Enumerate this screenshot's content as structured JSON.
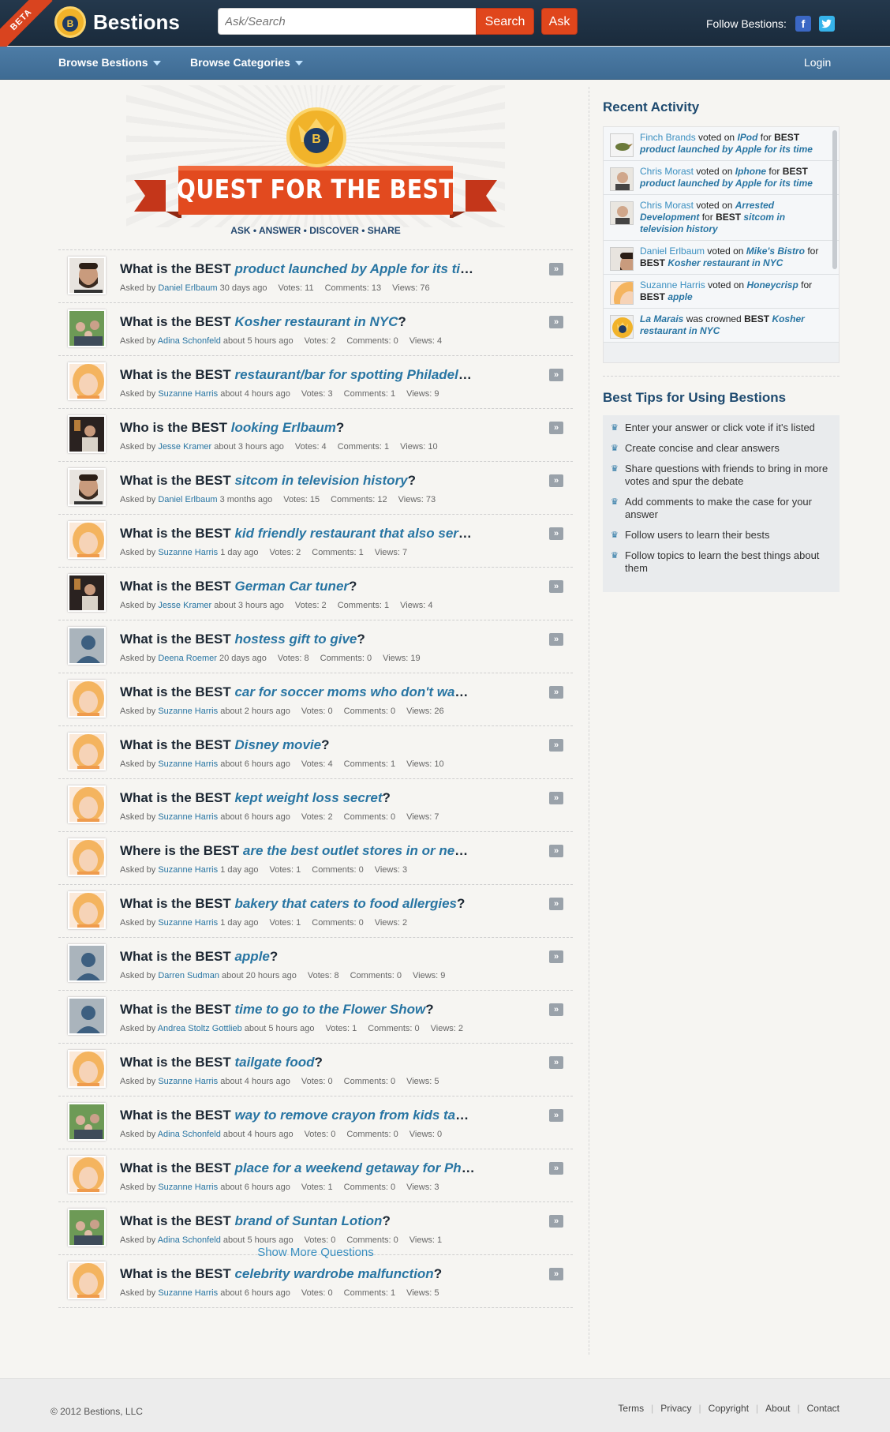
{
  "header": {
    "beta": "BETA",
    "logo_letter": "B",
    "logo_text": "Bestions",
    "search_placeholder": "Ask/Search",
    "search_label": "Search",
    "ask_label": "Ask",
    "follow_label": "Follow Bestions:",
    "facebook": "f",
    "twitter": "t"
  },
  "nav": {
    "browse_bestions": "Browse Bestions",
    "browse_categories": "Browse Categories",
    "login": "Login"
  },
  "hero": {
    "badge_letter": "B",
    "banner": "QUEST FOR THE BEST",
    "tagline": "ASK • ANSWER • DISCOVER • SHARE"
  },
  "questions": [
    {
      "prefix": "What is the BEST",
      "topic": "product launched by Apple for its time",
      "suffix": "?",
      "asker": "Daniel Erlbaum",
      "time": "30 days ago",
      "votes": "Votes: 11",
      "comments": "Comments: 13",
      "views": "Views: 76",
      "avatar": "man-beard"
    },
    {
      "prefix": "What is the BEST",
      "topic": "Kosher restaurant in NYC",
      "suffix": "?",
      "asker": "Adina Schonfeld",
      "time": "about 5 hours ago",
      "votes": "Votes: 2",
      "comments": "Comments: 0",
      "views": "Views: 4",
      "avatar": "family"
    },
    {
      "prefix": "What is the BEST",
      "topic": "restaurant/bar for spotting Philadelphia c...",
      "suffix": "",
      "asker": "Suzanne Harris",
      "time": "about 4 hours ago",
      "votes": "Votes: 3",
      "comments": "Comments: 1",
      "views": "Views: 9",
      "avatar": "blonde"
    },
    {
      "prefix": "Who is the BEST",
      "topic": "looking Erlbaum",
      "suffix": "?",
      "asker": "Jesse Kramer",
      "time": "about 3 hours ago",
      "votes": "Votes: 4",
      "comments": "Comments: 1",
      "views": "Views: 10",
      "avatar": "dark"
    },
    {
      "prefix": "What is the BEST",
      "topic": "sitcom in television history",
      "suffix": "?",
      "asker": "Daniel Erlbaum",
      "time": "3 months ago",
      "votes": "Votes: 15",
      "comments": "Comments: 12",
      "views": "Views: 73",
      "avatar": "man-beard"
    },
    {
      "prefix": "What is the BEST",
      "topic": "kid friendly restaurant that also serves alc...",
      "suffix": "",
      "asker": "Suzanne Harris",
      "time": "1 day ago",
      "votes": "Votes: 2",
      "comments": "Comments: 1",
      "views": "Views: 7",
      "avatar": "blonde"
    },
    {
      "prefix": "What is the BEST",
      "topic": "German Car tuner",
      "suffix": "?",
      "asker": "Jesse Kramer",
      "time": "about 3 hours ago",
      "votes": "Votes: 2",
      "comments": "Comments: 1",
      "views": "Views: 4",
      "avatar": "dark"
    },
    {
      "prefix": "What is the BEST",
      "topic": "hostess gift to give",
      "suffix": "?",
      "asker": "Deena Roemer",
      "time": "20 days ago",
      "votes": "Votes: 8",
      "comments": "Comments: 0",
      "views": "Views: 19",
      "avatar": "default"
    },
    {
      "prefix": "What is the BEST",
      "topic": "car for soccer moms who don't want to lo...",
      "suffix": "",
      "asker": "Suzanne Harris",
      "time": "about 2 hours ago",
      "votes": "Votes: 0",
      "comments": "Comments: 0",
      "views": "Views: 26",
      "avatar": "blonde"
    },
    {
      "prefix": "What is the BEST",
      "topic": "Disney movie",
      "suffix": "?",
      "asker": "Suzanne Harris",
      "time": "about 6 hours ago",
      "votes": "Votes: 4",
      "comments": "Comments: 1",
      "views": "Views: 10",
      "avatar": "blonde"
    },
    {
      "prefix": "What is the BEST",
      "topic": "kept weight loss secret",
      "suffix": "?",
      "asker": "Suzanne Harris",
      "time": "about 6 hours ago",
      "votes": "Votes: 2",
      "comments": "Comments: 0",
      "views": "Views: 7",
      "avatar": "blonde"
    },
    {
      "prefix": "Where is the BEST",
      "topic": "are the best outlet stores in or near Phila...",
      "suffix": "",
      "asker": "Suzanne Harris",
      "time": "1 day ago",
      "votes": "Votes: 1",
      "comments": "Comments: 0",
      "views": "Views: 3",
      "avatar": "blonde"
    },
    {
      "prefix": "What is the BEST",
      "topic": "bakery that caters to food allergies",
      "suffix": "?",
      "asker": "Suzanne Harris",
      "time": "1 day ago",
      "votes": "Votes: 1",
      "comments": "Comments: 0",
      "views": "Views: 2",
      "avatar": "blonde"
    },
    {
      "prefix": "What is the BEST",
      "topic": "apple",
      "suffix": "?",
      "asker": "Darren Sudman",
      "time": "about 20 hours ago",
      "votes": "Votes: 8",
      "comments": "Comments: 0",
      "views": "Views: 9",
      "avatar": "default"
    },
    {
      "prefix": "What is the BEST",
      "topic": "time to go to the Flower Show",
      "suffix": "?",
      "asker": "Andrea Stoltz Gottlieb",
      "time": "about 5 hours ago",
      "votes": "Votes: 1",
      "comments": "Comments: 0",
      "views": "Views: 2",
      "avatar": "default"
    },
    {
      "prefix": "What is the BEST",
      "topic": "tailgate food",
      "suffix": "?",
      "asker": "Suzanne Harris",
      "time": "about 4 hours ago",
      "votes": "Votes: 0",
      "comments": "Comments: 0",
      "views": "Views: 5",
      "avatar": "blonde"
    },
    {
      "prefix": "What is the BEST",
      "topic": "way to remove crayon from kids table and...",
      "suffix": "",
      "asker": "Adina Schonfeld",
      "time": "about 4 hours ago",
      "votes": "Votes: 0",
      "comments": "Comments: 0",
      "views": "Views: 0",
      "avatar": "family"
    },
    {
      "prefix": "What is the BEST",
      "topic": "place for a weekend getaway for Philadel...",
      "suffix": "",
      "asker": "Suzanne Harris",
      "time": "about 6 hours ago",
      "votes": "Votes: 1",
      "comments": "Comments: 0",
      "views": "Views: 3",
      "avatar": "blonde"
    },
    {
      "prefix": "What is the BEST",
      "topic": "brand of Suntan Lotion",
      "suffix": "?",
      "asker": "Adina Schonfeld",
      "time": "about 5 hours ago",
      "votes": "Votes: 0",
      "comments": "Comments: 0",
      "views": "Views: 1",
      "avatar": "family"
    },
    {
      "prefix": "What is the BEST",
      "topic": "celebrity wardrobe malfunction",
      "suffix": "?",
      "asker": "Suzanne Harris",
      "time": "about 6 hours ago",
      "votes": "Votes: 0",
      "comments": "Comments: 1",
      "views": "Views: 5",
      "avatar": "blonde"
    }
  ],
  "asked_by": "Asked by",
  "show_more": "Show More Questions",
  "sidebar": {
    "recent_title": "Recent Activity",
    "activity": [
      {
        "user": "Finch Brands",
        "verb": "voted on",
        "item": "IPod",
        "for": "for",
        "best": "BEST",
        "topic": "product launched by Apple for its time",
        "thumb": "bird"
      },
      {
        "user": "Chris Morast",
        "verb": "voted on",
        "item": "Iphone",
        "for": "for",
        "best": "BEST",
        "topic": "product launched by Apple for its time",
        "thumb": "man"
      },
      {
        "user": "Chris Morast",
        "verb": "voted on",
        "item": "Arrested Development",
        "for": "for",
        "best": "BEST",
        "topic": "sitcom in television history",
        "thumb": "man"
      },
      {
        "user": "Daniel Erlbaum",
        "verb": "voted on",
        "item": "Mike's Bistro",
        "for": "for",
        "best": "BEST",
        "topic": "Kosher restaurant in NYC",
        "thumb": "man-beard"
      },
      {
        "user": "Suzanne Harris",
        "verb": "voted on",
        "item": "Honeycrisp",
        "for": "for",
        "best": "BEST",
        "topic": "apple",
        "thumb": "blonde"
      },
      {
        "user": "",
        "verb": "was crowned",
        "item": "La Marais",
        "for": "",
        "best": "BEST",
        "topic": "Kosher restaurant in NYC",
        "thumb": "crown"
      }
    ],
    "tips_title": "Best Tips for Using Bestions",
    "tips": [
      "Enter your answer or click vote if it's listed",
      "Create concise and clear answers",
      "Share questions with friends to bring in more votes and spur the debate",
      "Add comments to make the case for your answer",
      "Follow users to learn their bests",
      "Follow topics to learn the best things about them"
    ]
  },
  "footer": {
    "copyright": "© 2012 Bestions, LLC",
    "links": [
      "Terms",
      "Privacy",
      "Copyright",
      "About",
      "Contact"
    ]
  },
  "colors": {
    "brand_dark": "#1f3145",
    "nav_blue": "#4676a0",
    "accent_orange": "#e0461c",
    "link_blue": "#2875a3",
    "crown_gold": "#f1b32a"
  }
}
